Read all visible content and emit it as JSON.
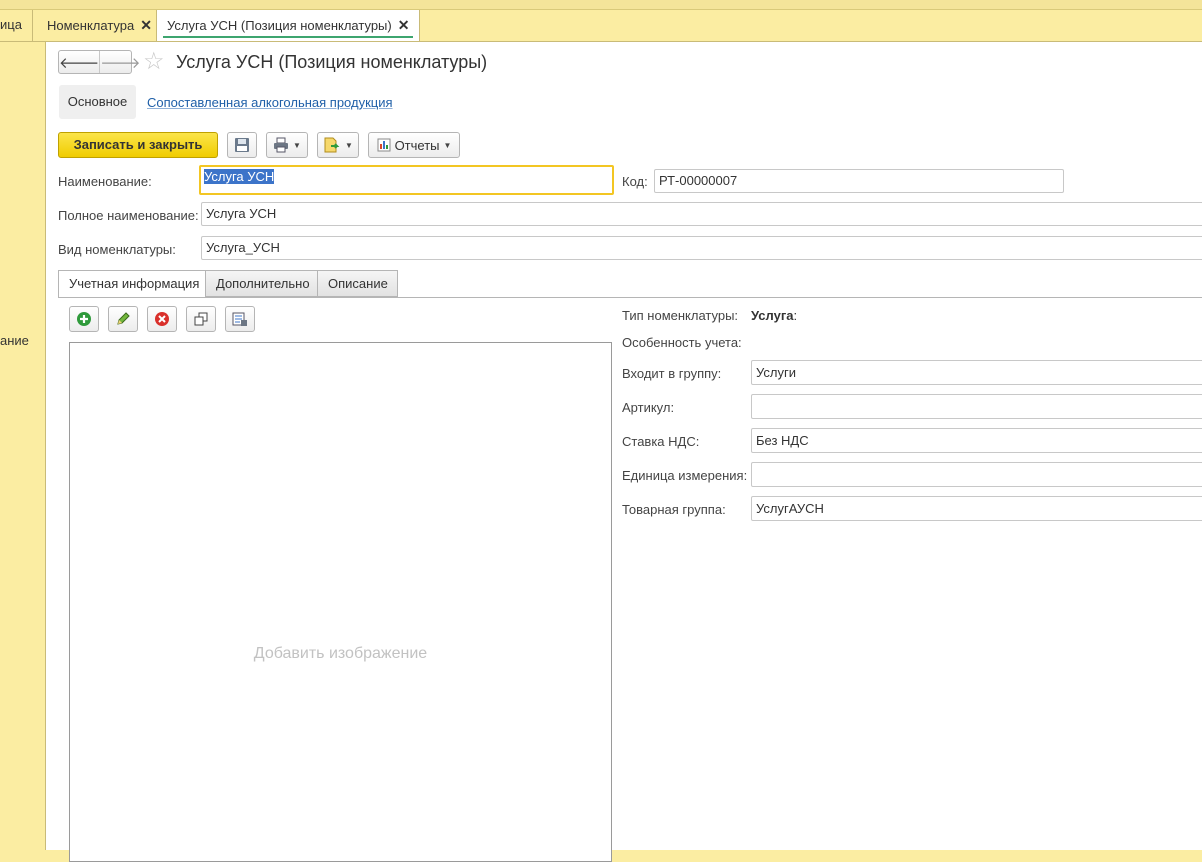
{
  "window_tabs": [
    {
      "label": "ица",
      "closable": false
    },
    {
      "label": "Номенклатура",
      "closable": true
    },
    {
      "label": "Услуга УСН (Позиция номенклатуры)",
      "closable": true,
      "active": true
    }
  ],
  "sidebar": {
    "partial_label": "ание"
  },
  "header": {
    "back_icon": "arrow-left-icon",
    "forward_icon": "arrow-right-icon",
    "favorite_icon": "star-icon",
    "title": "Услуга УСН (Позиция номенклатуры)"
  },
  "section_tabs": {
    "main": "Основное",
    "link": "Сопоставленная алкогольная продукция"
  },
  "toolbar": {
    "save_close": "Записать и закрыть",
    "save_icon": "floppy-disk-icon",
    "print_icon": "printer-icon",
    "create_based_icon": "document-arrow-icon",
    "reports": "Отчеты",
    "reports_icon": "report-icon"
  },
  "form": {
    "name_label": "Наименование:",
    "name_value": "Услуга УСН",
    "code_label": "Код:",
    "code_value": "РТ-00000007",
    "full_name_label": "Полное наименование:",
    "full_name_value": "Услуга УСН",
    "kind_label": "Вид номенклатуры:",
    "kind_value": "Услуга_УСН"
  },
  "panel_tabs": [
    "Учетная информация",
    "Дополнительно",
    "Описание"
  ],
  "image_toolbar": [
    "add-icon",
    "edit-pencil-icon",
    "delete-icon",
    "copy-icon",
    "properties-icon"
  ],
  "image_placeholder": "Добавить изображение",
  "details": {
    "type_label": "Тип номенклатуры:",
    "type_value": "Услуга",
    "feature_label": "Особенность учета:",
    "group_label": "Входит в группу:",
    "group_value": "Услуги",
    "article_label": "Артикул:",
    "article_value": "",
    "vat_label": "Ставка НДС:",
    "vat_value": "Без НДС",
    "unit_label": "Единица измерения:",
    "unit_value": "",
    "goods_group_label": "Товарная группа:",
    "goods_group_value": "УслугАУСН"
  }
}
